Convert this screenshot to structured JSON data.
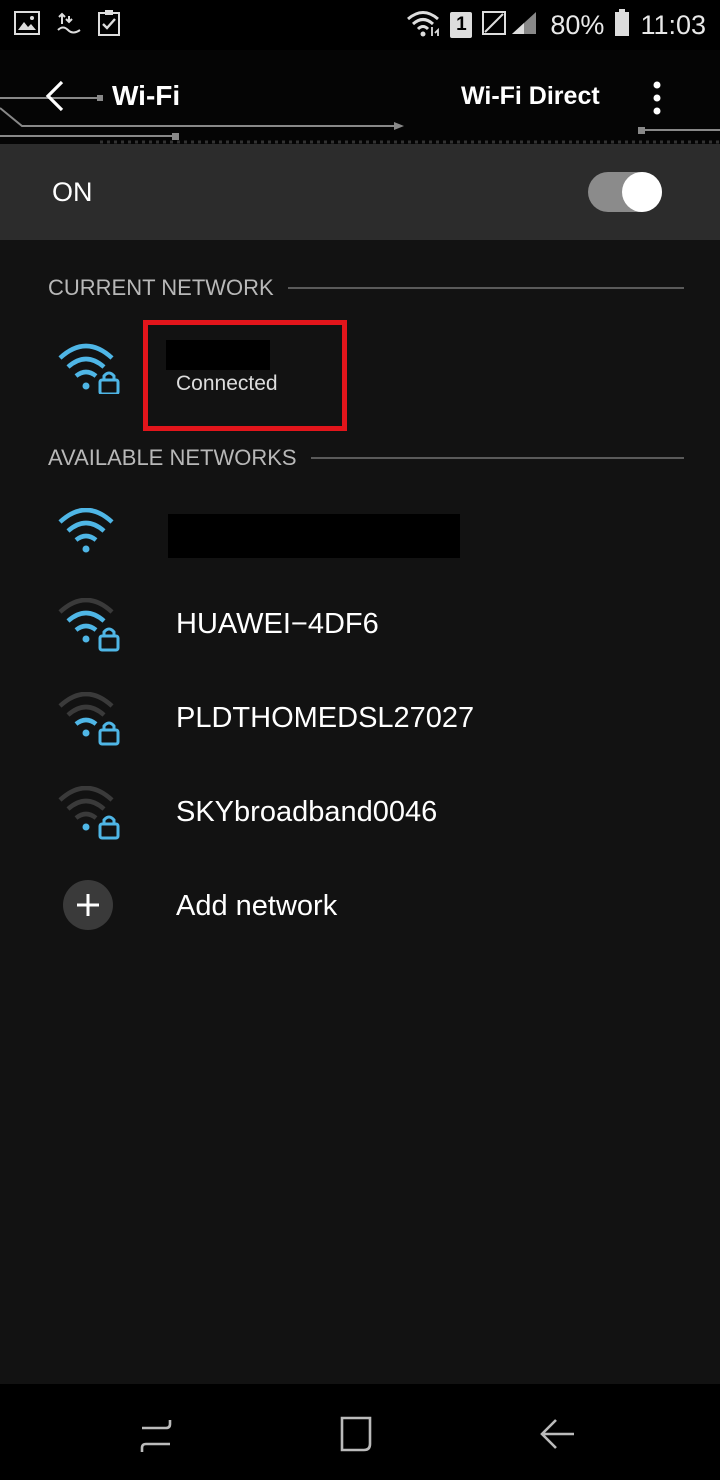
{
  "status_bar": {
    "battery_text": "80%",
    "time": "11:03",
    "sim_slot": "1",
    "left_icons": [
      "image-icon",
      "sync-icon",
      "checkbox-icon"
    ],
    "right_icons": [
      "wifi-icon",
      "signal-icon",
      "battery-icon"
    ]
  },
  "app_bar": {
    "title": "Wi-Fi",
    "wifi_direct_label": "Wi-Fi Direct"
  },
  "toggle": {
    "label": "ON",
    "state": true
  },
  "current_network": {
    "header": "CURRENT NETWORK",
    "status": "Connected",
    "secured": true
  },
  "available_networks": {
    "header": "AVAILABLE NETWORKS",
    "items": [
      {
        "name": "",
        "secured": false,
        "strength": 3
      },
      {
        "name": "HUAWEI−4DF6",
        "secured": true,
        "strength": 2
      },
      {
        "name": "PLDTHOMEDSL27027",
        "secured": true,
        "strength": 1
      },
      {
        "name": "SKYbroadband0046",
        "secured": true,
        "strength": 1
      }
    ]
  },
  "add_network": {
    "label": "Add network"
  },
  "colors": {
    "accent_wifi": "#4fb6e6",
    "highlight_red": "#e2151b",
    "background": "#121212"
  }
}
